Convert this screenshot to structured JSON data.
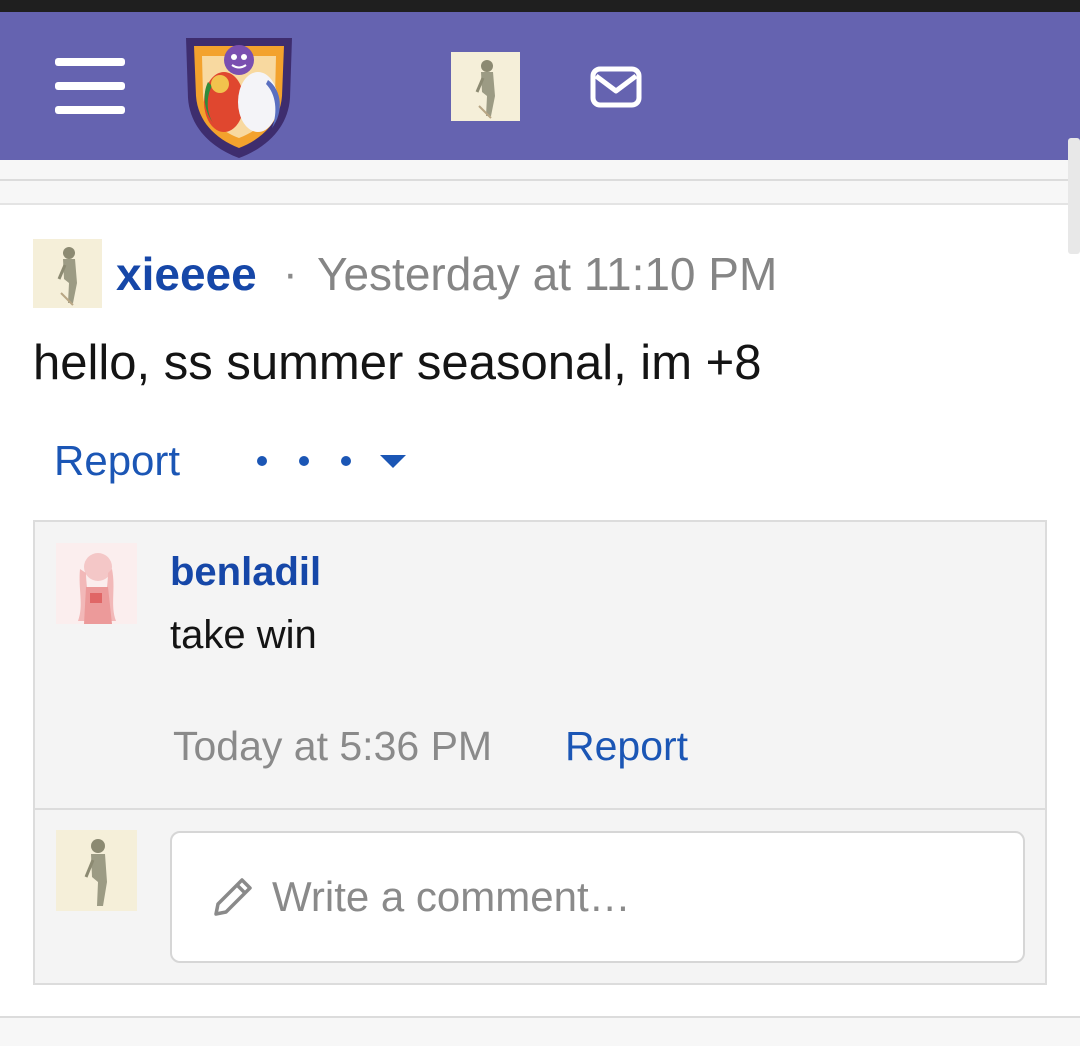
{
  "header": {
    "menu_icon": "hamburger-menu-icon",
    "logo_icon": "forum-logo-shield-icon",
    "avatar_icon": "user-avatar-icon",
    "inbox_icon": "envelope-icon",
    "background": "#6563b0"
  },
  "post": {
    "author": "xieeee",
    "separator": "·",
    "timestamp": "Yesterday at 11:10 PM",
    "text": "hello, ss summer seasonal, im +8",
    "report_label": "Report",
    "more_icon": "more-options-dropdown-icon"
  },
  "comment": {
    "author": "benladil",
    "text": "take win",
    "timestamp": "Today at 5:36 PM",
    "report_label": "Report"
  },
  "write_comment": {
    "placeholder": "Write a comment…",
    "icon": "pencil-icon"
  },
  "colors": {
    "link": "#1b56b5",
    "username": "#1647a8",
    "muted": "#858585"
  }
}
